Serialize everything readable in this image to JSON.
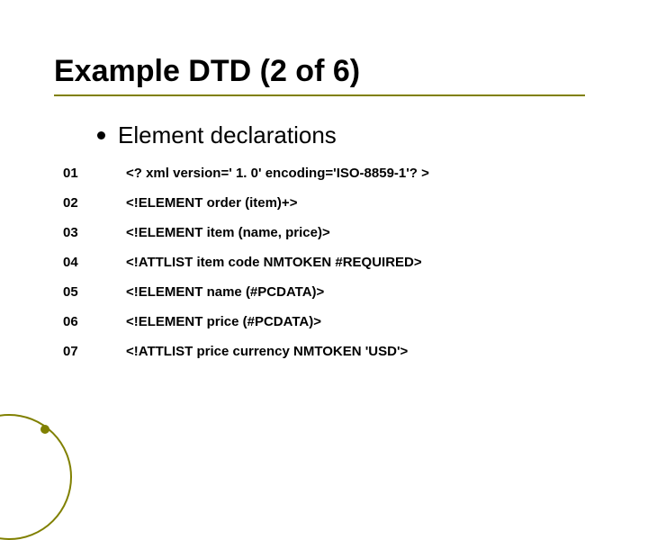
{
  "title": "Example DTD (2 of 6)",
  "subtitle": "Element declarations",
  "lines": [
    {
      "num": "01",
      "code": "<? xml version=' 1. 0' encoding='ISO-8859-1'? >"
    },
    {
      "num": "02",
      "code": "<!ELEMENT order (item)+>"
    },
    {
      "num": "03",
      "code": "<!ELEMENT item (name, price)>"
    },
    {
      "num": "04",
      "code": "<!ATTLIST item code NMTOKEN #REQUIRED>"
    },
    {
      "num": "05",
      "code": "<!ELEMENT name (#PCDATA)>"
    },
    {
      "num": "06",
      "code": "<!ELEMENT price (#PCDATA)>"
    },
    {
      "num": "07",
      "code": "<!ATTLIST price currency NMTOKEN 'USD'>"
    }
  ]
}
